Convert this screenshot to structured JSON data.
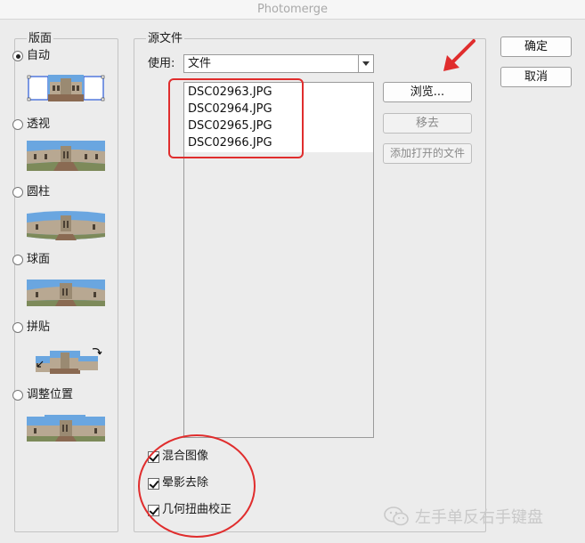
{
  "window": {
    "title": "Photomerge"
  },
  "layout": {
    "legend": "版面",
    "options": [
      {
        "label": "自动",
        "selected": true
      },
      {
        "label": "透视",
        "selected": false
      },
      {
        "label": "圆柱",
        "selected": false
      },
      {
        "label": "球面",
        "selected": false
      },
      {
        "label": "拼贴",
        "selected": false
      },
      {
        "label": "调整位置",
        "selected": false
      }
    ]
  },
  "source": {
    "legend": "源文件",
    "use_label": "使用:",
    "use_value": "文件",
    "files": [
      "DSC02963.JPG",
      "DSC02964.JPG",
      "DSC02965.JPG",
      "DSC02966.JPG"
    ],
    "browse_label": "浏览...",
    "remove_label": "移去",
    "add_open_label": "添加打开的文件"
  },
  "options": {
    "blend": {
      "label": "混合图像",
      "checked": true
    },
    "vignette": {
      "label": "晕影去除",
      "checked": true
    },
    "distortion": {
      "label": "几何扭曲校正",
      "checked": true
    }
  },
  "actions": {
    "ok_label": "确定",
    "cancel_label": "取消"
  },
  "watermark": {
    "text": "左手单反右手键盘"
  },
  "colors": {
    "annotation": "#e02d2d",
    "sky": "#6aa6e0",
    "building": "#b8a892",
    "ground": "#8a6a52"
  }
}
